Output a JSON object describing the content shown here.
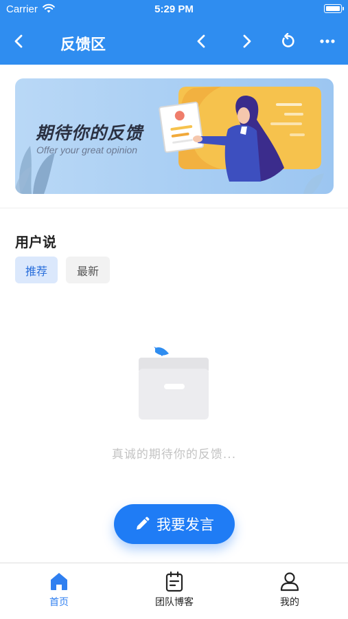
{
  "status_bar": {
    "carrier": "Carrier",
    "time": "5:29 PM"
  },
  "header": {
    "title": "反馈区"
  },
  "banner": {
    "title": "期待你的反馈",
    "subtitle": "Offer your great opinion"
  },
  "section": {
    "title": "用户说",
    "filters": [
      {
        "label": "推荐",
        "active": true
      },
      {
        "label": "最新",
        "active": false
      }
    ]
  },
  "empty_state": {
    "text": "真诚的期待你的反馈..."
  },
  "fab": {
    "label": "我要发言"
  },
  "tabbar": {
    "tabs": [
      {
        "label": "首页",
        "icon": "home-icon",
        "active": true
      },
      {
        "label": "团队博客",
        "icon": "calendar-note-icon",
        "active": false
      },
      {
        "label": "我的",
        "icon": "user-icon",
        "active": false
      }
    ]
  },
  "colors": {
    "primary": "#2f8df0",
    "accent": "#1f7cf5",
    "active_tab": "#2f7ff0"
  }
}
